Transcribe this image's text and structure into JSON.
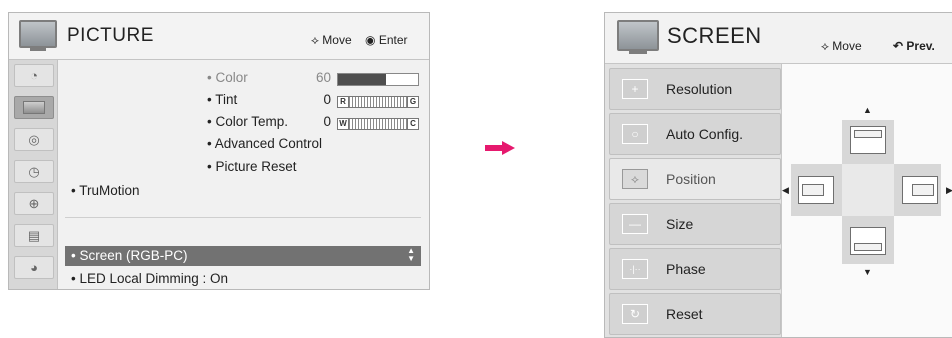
{
  "picture_panel": {
    "title": "PICTURE",
    "hint_move": "Move",
    "hint_enter": "Enter",
    "submenu": [
      {
        "label": "• Color",
        "value": "60",
        "dim": true,
        "level": 0.6
      },
      {
        "label": "• Tint",
        "value": "0",
        "gauge_left": "R",
        "gauge_right": "G"
      },
      {
        "label": "• Color Temp.",
        "value": "0",
        "gauge_left": "W",
        "gauge_right": "C"
      },
      {
        "label": "• Advanced Control"
      },
      {
        "label": "• Picture Reset"
      }
    ],
    "items": [
      {
        "label": "• TruMotion"
      },
      {
        "label": "• Screen (RGB-PC)",
        "selected": true
      },
      {
        "label": "• LED Local Dimming : On"
      }
    ],
    "sidebar_icons": [
      "satellite-dish-icon",
      "tv-picture-icon",
      "speaker-icon",
      "clock-icon",
      "lock-icon",
      "option-icon",
      "globe-icon"
    ]
  },
  "transition_arrow": {
    "color": "#e6196e"
  },
  "screen_panel": {
    "title": "SCREEN",
    "hint_move": "Move",
    "hint_prev": "Prev.",
    "menu": [
      {
        "label": "Resolution",
        "icon": "plus-icon"
      },
      {
        "label": "Auto Config.",
        "icon": "circle-icon"
      },
      {
        "label": "Position",
        "icon": "position-arrows-icon",
        "active": true
      },
      {
        "label": "Size",
        "icon": "size-line-icon"
      },
      {
        "label": "Phase",
        "icon": "phase-icon"
      },
      {
        "label": "Reset",
        "icon": "reset-icon"
      }
    ]
  }
}
